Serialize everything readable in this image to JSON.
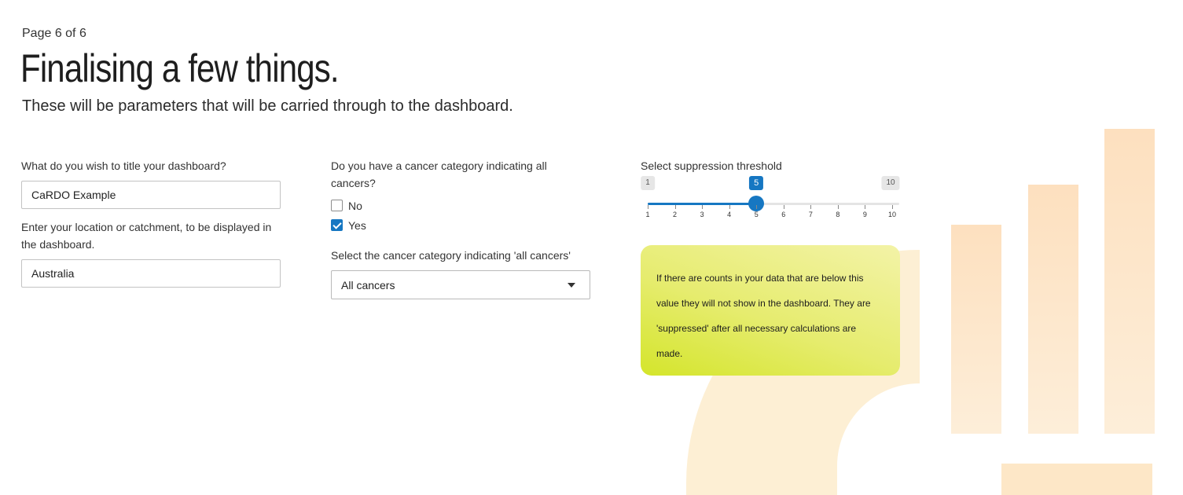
{
  "page_indicator": "Page 6 of 6",
  "title": "Finalising a few things.",
  "subtitle": "These will be parameters that will be carried through to the dashboard.",
  "dashboard_title": {
    "label": "What do you wish to title your dashboard?",
    "value": "CaRDO Example"
  },
  "location": {
    "label": "Enter your location or catchment, to be displayed in the dashboard.",
    "value": "Australia"
  },
  "all_cancers_question": {
    "label": "Do you have a cancer category indicating all cancers?",
    "options": [
      {
        "label": "No",
        "checked": false
      },
      {
        "label": "Yes",
        "checked": true
      }
    ]
  },
  "cancer_category_select": {
    "label": "Select the cancer category indicating 'all cancers'",
    "value": "All cancers"
  },
  "suppression": {
    "label": "Select suppression threshold",
    "min": 1,
    "max": 10,
    "value": 5,
    "min_label": "1",
    "max_label": "10",
    "value_label": "5",
    "ticks": [
      "1",
      "2",
      "3",
      "4",
      "5",
      "6",
      "7",
      "8",
      "9",
      "10"
    ],
    "info_text": "If there are counts in your data that are below this value they will not show in the dashboard. They are 'suppressed' after all necessary calculations are made."
  },
  "colors": {
    "accent": "#1677c2",
    "info_gradient_start": "#f3f3a7",
    "info_gradient_end": "#d4e52b",
    "bg_shapes": "#fde2c2"
  }
}
